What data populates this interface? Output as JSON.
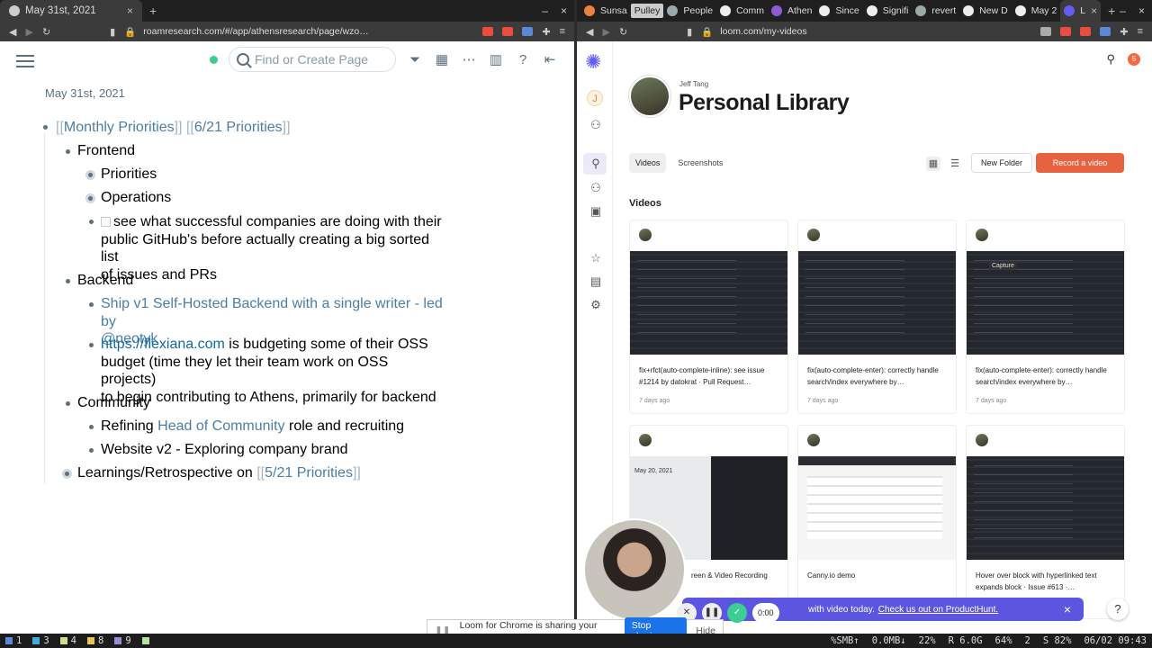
{
  "left_window": {
    "tab_title": "May 31st, 2021",
    "tab_close": "×",
    "new_tab": "+",
    "window_controls": [
      "–",
      "×"
    ],
    "url": "roamresearch.com/#/app/athensresearch/page/wzo…"
  },
  "roam": {
    "search_placeholder": "Find or Create Page",
    "page_title": "May 31st, 2021",
    "blocks": {
      "monthly": "[[",
      "monthly_ref": "Monthly Priorities",
      "monthly_close": "]]",
      "june_open": "[[",
      "june_ref": "6/21 Priorities",
      "june_close": "]]",
      "frontend": "Frontend",
      "priorities": "Priorities",
      "operations": "Operations",
      "todo_line1": "see what successful companies are doing with their",
      "todo_line2": "public GitHub's before actually creating a big sorted list",
      "todo_line3": "of issues and PRs",
      "backend": "Backend",
      "ship_line1": "Ship v1 Self-Hosted Backend with a single writer - led by",
      "ship_line2": "@neotyk",
      "flexiana_link": "https://flexiana.com",
      "flexiana_rest1": " is budgeting some of their OSS",
      "flexiana_line2": "budget (time they let their team work on OSS projects)",
      "flexiana_line3": "to begin contributing to Athens, primarily for backend",
      "community": "Community",
      "refining_pre": "Refining ",
      "refining_ref": "Head of Community",
      "refining_post": " role and recruiting",
      "website": "Website v2 - Exploring company brand",
      "learnings_pre": "Learnings/Retrospective on ",
      "learnings_open": "[[",
      "learnings_ref": "5/21 Priorities",
      "learnings_close": "]]"
    }
  },
  "right_window": {
    "tabs": [
      "Sunsa",
      "Pulley",
      "People",
      "Comm",
      "Athen",
      "Since",
      "Signifi",
      "revert",
      "New D",
      "May 2",
      "L"
    ],
    "tab_close": "×",
    "new_tab": "+",
    "window_controls": [
      "–",
      "×"
    ],
    "url": "loom.com/my-videos"
  },
  "loom": {
    "rail_initial": "J",
    "notification_count": "5",
    "owner": "Jeff Tang",
    "title": "Personal Library",
    "tab_videos": "Videos",
    "tab_screenshots": "Screenshots",
    "new_folder": "New Folder",
    "record": "Record a video",
    "section_title": "Videos",
    "cards": [
      {
        "title": "fix+rfct(auto-complete-inline): see issue #1214 by datokrat · Pull Request…",
        "ago": "7 days ago"
      },
      {
        "title": "fix(auto-complete-enter): correctly handle search/index everywhere by…",
        "ago": "7 days ago"
      },
      {
        "title": "fix(auto-complete-enter): correctly handle search/index everywhere by…",
        "ago": "7 days ago",
        "thumb_label": "Capture"
      },
      {
        "title": "reen & Video Recording",
        "ago": "",
        "thumb_label": "May 20, 2021"
      },
      {
        "title": "Canny.io demo",
        "ago": ""
      },
      {
        "title": "Hover over block with hyperlinked text expands block · Issue #613 ·…",
        "ago": ""
      }
    ],
    "promo_text": "with video today.",
    "promo_link": "Check us out on ProductHunt.",
    "promo_close": "×",
    "help": "?",
    "timer": "0:00"
  },
  "share_bar": {
    "message": "Loom for Chrome is sharing your screen.",
    "stop": "Stop sharing",
    "hide": "Hide"
  },
  "statusbar": {
    "workspaces": [
      "1",
      "3",
      "4",
      "8",
      "9"
    ],
    "right": [
      "%SMB↑",
      "0.0MB↓",
      "22%",
      "R 6.0G",
      "64%",
      "2",
      "S 82%",
      "06/02 09:43"
    ]
  }
}
